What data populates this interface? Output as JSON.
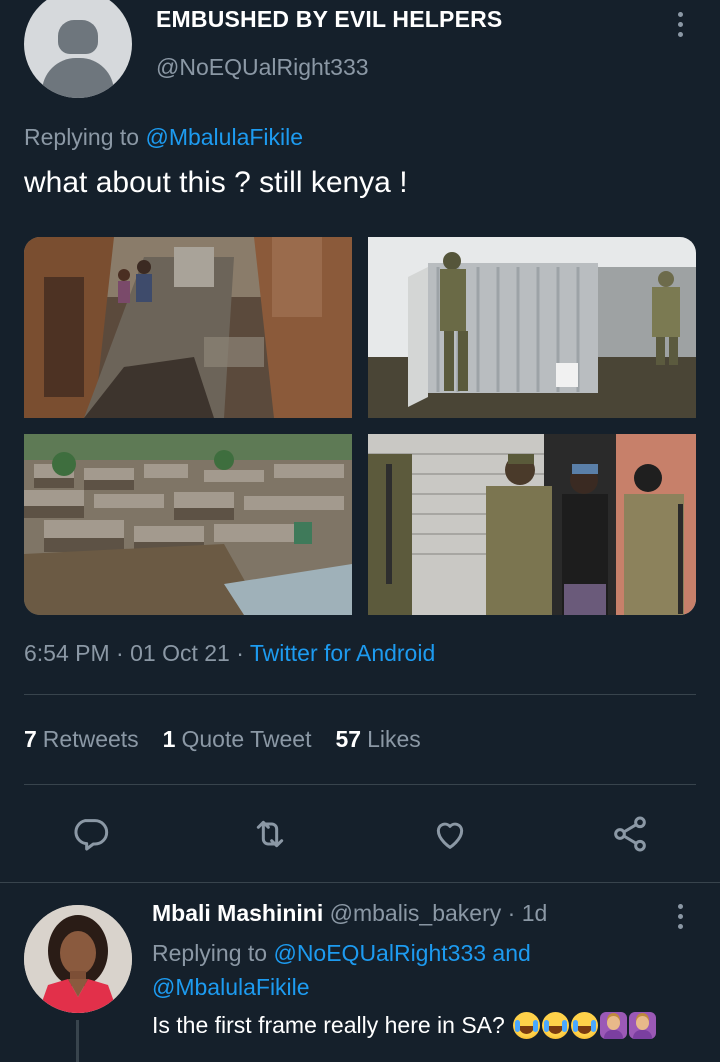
{
  "tweet": {
    "author_name": "EMBUSHED BY EVIL HELPERS",
    "author_handle": "@NoEQUalRight333",
    "replying_prefix": "Replying to",
    "replying_to": "@MbalulaFikile",
    "text": "what about this ? still kenya !",
    "time": "6:54 PM",
    "date": "01 Oct 21",
    "source": "Twitter for Android",
    "sep": "·",
    "retweets_count": "7",
    "retweets_label": "Retweets",
    "quotes_count": "1",
    "quotes_label": "Quote Tweet",
    "likes_count": "57",
    "likes_label": "Likes",
    "photos": [
      "kenya-slum-street-photo",
      "soldiers-shack-photo",
      "slum-aerial-photo",
      "soldiers-door-photo"
    ]
  },
  "reply": {
    "name": "Mbali Mashinini",
    "handle": "@mbalis_bakery",
    "time": "1d",
    "sep": "·",
    "replying_prefix": "Replying to",
    "replying_to_1": "@NoEQUalRight333",
    "and": "and",
    "replying_to_2": "@MbalulaFikile",
    "text": "Is the first frame really here in SA?"
  },
  "colors": {
    "background": "#15202b",
    "accent": "#1d9bf0",
    "secondary_text": "#8b98a5",
    "divider": "#38444d"
  },
  "icons": [
    "reply-icon",
    "retweet-icon",
    "like-icon",
    "share-icon",
    "more-icon"
  ]
}
